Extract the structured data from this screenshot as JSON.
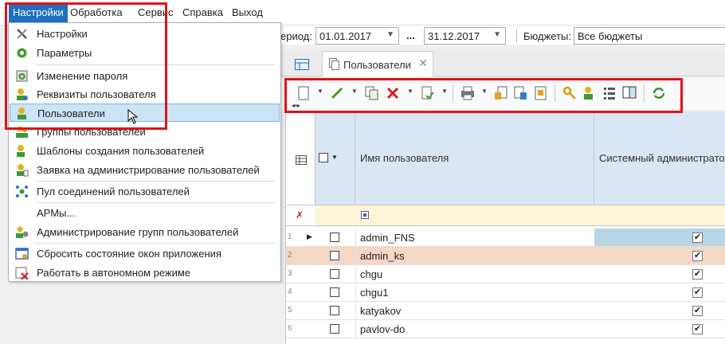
{
  "menubar": {
    "items": [
      "Настройки",
      "Обработка",
      "Сервис",
      "Справка",
      "Выход"
    ]
  },
  "filter": {
    "period_label": "ериод:",
    "date_from": "01.01.2017",
    "range_sep": "...",
    "date_to": "31.12.2017",
    "budgets_label": "Бюджеты:",
    "budgets_value": "Все бюджеты"
  },
  "tabs": {
    "users_label": "Пользователи"
  },
  "grid": {
    "columns": [
      "Имя пользователя",
      "Системный администратор"
    ],
    "rows": [
      {
        "num": "1",
        "name": "admin_FNS",
        "admin": "✔"
      },
      {
        "num": "2",
        "name": "admin_ks",
        "admin": "✔"
      },
      {
        "num": "3",
        "name": "chgu",
        "admin": "✔"
      },
      {
        "num": "4",
        "name": "chgu1",
        "admin": "✔"
      },
      {
        "num": "5",
        "name": "katyakov",
        "admin": "✔"
      },
      {
        "num": "6",
        "name": "pavlov-do",
        "admin": "✔"
      }
    ]
  },
  "menu": {
    "items": [
      {
        "label": "Настройки",
        "icon": "wrench-icon"
      },
      {
        "label": "Параметры",
        "icon": "gear-icon"
      },
      {
        "label": "Изменение пароля",
        "icon": "password-icon"
      },
      {
        "label": "Реквизиты пользователя",
        "icon": "user-details-icon"
      },
      {
        "label": "Пользователи",
        "icon": "users-icon"
      },
      {
        "label": "Группы пользователей",
        "icon": "user-groups-icon"
      },
      {
        "label": "Шаблоны создания пользователей",
        "icon": "user-template-icon"
      },
      {
        "label": "Заявка на администрирование пользователей",
        "icon": "admin-request-icon"
      },
      {
        "label": "Пул соединений пользователей",
        "icon": "connection-pool-icon"
      },
      {
        "label": "АРМы...",
        "icon": ""
      },
      {
        "label": "Администрирование групп пользователей",
        "icon": "group-admin-icon"
      },
      {
        "label": "Сбросить состояние окон приложения",
        "icon": "reset-windows-icon"
      },
      {
        "label": "Работать в автономном режиме",
        "icon": "offline-icon"
      }
    ]
  },
  "colors": {
    "accent": "#1f6fc0",
    "highlight_box": "#e0121a",
    "selected_row": "#b7d5e2",
    "alt_row": "#f5d7c6"
  }
}
